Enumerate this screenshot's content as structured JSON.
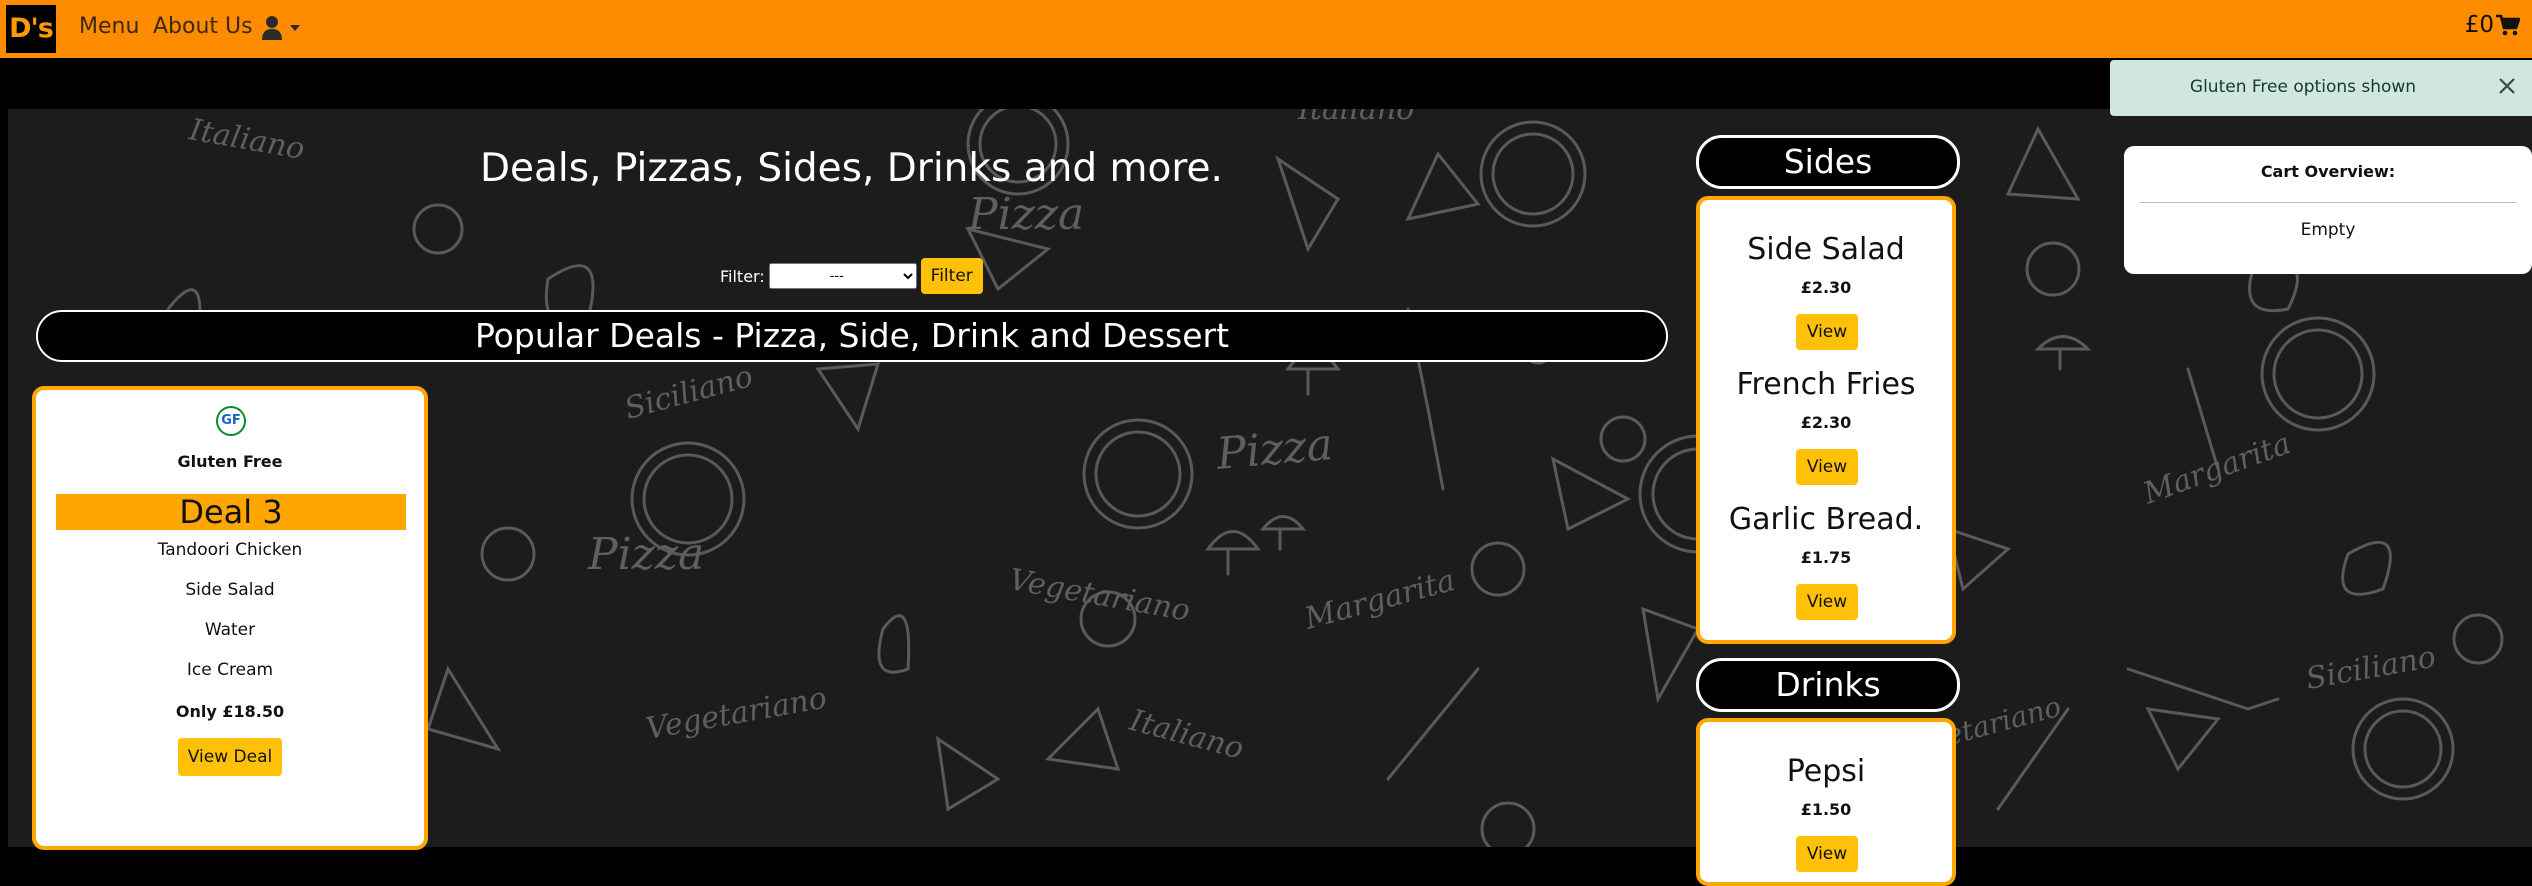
{
  "nav": {
    "brand": "D's",
    "menu": "Menu",
    "about": "About Us",
    "cart_total": "£0"
  },
  "toast": {
    "message": "Gluten Free options shown"
  },
  "cart_overview": {
    "title": "Cart Overview:",
    "status": "Empty"
  },
  "hero": {
    "title": "Deals, Pizzas, Sides, Drinks and more."
  },
  "filter": {
    "label": "Filter:",
    "selected": "---",
    "button": "Filter"
  },
  "deals": {
    "heading": "Popular Deals - Pizza, Side, Drink and Dessert",
    "card": {
      "badge": "GF",
      "badge_label": "Gluten Free",
      "title": "Deal 3",
      "items": [
        "Tandoori Chicken",
        "Side Salad",
        "Water",
        "Ice Cream"
      ],
      "price": "Only £18.50",
      "button": "View Deal"
    }
  },
  "sides": {
    "heading": "Sides",
    "items": [
      {
        "name": "Side Salad",
        "price": "£2.30",
        "button": "View"
      },
      {
        "name": "French Fries",
        "price": "£2.30",
        "button": "View"
      },
      {
        "name": "Garlic Bread.",
        "price": "£1.75",
        "button": "View"
      }
    ]
  },
  "drinks": {
    "heading": "Drinks",
    "items": [
      {
        "name": "Pepsi",
        "price": "£1.50",
        "button": "View"
      }
    ]
  },
  "background_words": [
    "Italiano",
    "Pizza",
    "Siciliano",
    "Vegetariano",
    "Margarita"
  ],
  "colors": {
    "nav": "#ff8c00",
    "accent": "#ffa600",
    "button": "#ffc107",
    "toast_bg": "#d1e7dd"
  }
}
